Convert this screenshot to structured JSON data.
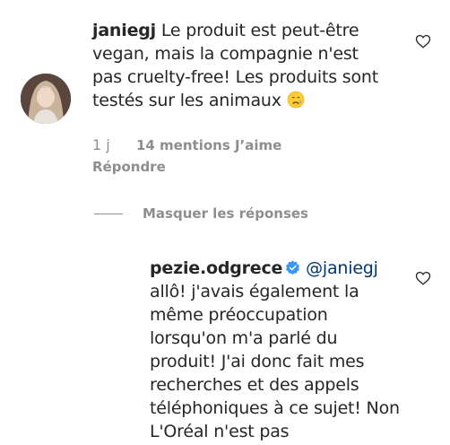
{
  "comment1": {
    "username": "janiegj",
    "text": "Le produit est peut-être vegan, mais la compagnie n'est pas cruelty-free! Les produits sont testés sur les animaux",
    "emoji": "disappointed-relieved-face-emoji",
    "time": "1 j",
    "likes": "14 mentions J’aime",
    "reply_label": "Répondre"
  },
  "hide_replies_label": "Masquer les réponses",
  "comment2": {
    "username": "pezie.odgrece",
    "mention": "@janiegj",
    "text": "allô! j'avais également la même préoccupation lorsqu'on m'a parlé du produit! J'ai donc fait mes recherches et des appels téléphoniques à ce sujet! Non L'Oréal n'est pas"
  },
  "colors": {
    "text": "#262626",
    "secondary": "#8e8e8e",
    "mention": "#00376b",
    "verified": "#3897f0"
  }
}
